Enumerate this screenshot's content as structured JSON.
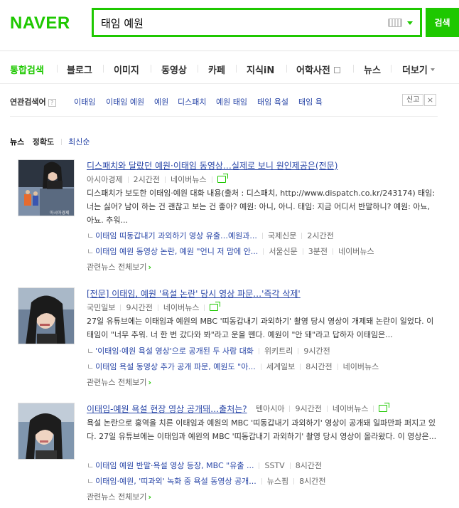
{
  "header": {
    "logo": "NAVER",
    "search_value": "태임 예원",
    "search_button": "검색"
  },
  "nav": {
    "tabs": [
      "통합검색",
      "블로그",
      "이미지",
      "동영상",
      "카페",
      "지식iN",
      "어학사전",
      "뉴스",
      "더보기"
    ]
  },
  "related": {
    "title": "연관검색어",
    "help": "?",
    "items": [
      "이태임",
      "이태임 예원",
      "예원",
      "디스패치",
      "예원 태임",
      "태임 욕설",
      "태임 욕"
    ],
    "report": "신고",
    "close": "×"
  },
  "news": {
    "section_title": "뉴스",
    "sort_accuracy": "정확도",
    "sort_latest": "최신순",
    "related_more": "관련뉴스 전체보기",
    "items": [
      {
        "title": "디스패치와 달랐던 예원·이태임 동영상…실제로 보니 원인제공은(전문)",
        "source": "아시아경제",
        "time": "2시간전",
        "portal": "네이버뉴스",
        "desc": "디스패치가 보도한 이태임·예원 대화 내용(출처 : 디스패치, http://www.dispatch.co.kr/243174) 태임: 너는 싫어? 남이 하는 건 괜찮고 보는 건 좋아? 예원: 아니, 아니. 태임: 지금 어디서 반말하니? 예원: 아뇨, 아뇨. 추워...",
        "subs": [
          {
            "title": "이태임 띠동갑내기 과외하기 영상 유출…예원과...",
            "source": "국제신문",
            "time": "2시간전",
            "portal": ""
          },
          {
            "title": "이태임 예원 동영상 논란, 예원 \"언니 저 맘에 안...",
            "source": "서울신문",
            "time": "3분전",
            "portal": "네이버뉴스"
          }
        ]
      },
      {
        "title": "[전문] 이태임, 예원 '욕설 논란' 당시 영상 파문…'즉각 삭제'",
        "source": "국민일보",
        "time": "9시간전",
        "portal": "네이버뉴스",
        "desc": "27일 유튜브에는 이태임과 예원의 MBC '띠동갑내기 과외하기' 촬영 당시 영상이 개제돼 논란이 일었다. 이태임이 \"너무 추워. 너 한 번 갔다와 봐\"라고 운을 뗀다. 예원이 \"안 돼\"라고 답하자 이태임은...",
        "subs": [
          {
            "title": "'이태임·예원 욕설 영상'으로 공개된 두 사람 대화",
            "source": "위키트리",
            "time": "9시간전",
            "portal": ""
          },
          {
            "title": "이태임 욕설 동영상 추가 공개 파문, 예원도 \"아...",
            "source": "세계일보",
            "time": "8시간전",
            "portal": "네이버뉴스"
          }
        ]
      },
      {
        "title": "이태임-예원 욕설 현장 영상 공개돼…출처는?",
        "source": "텐아시아",
        "time": "9시간전",
        "portal": "네이버뉴스",
        "desc": "욕설 논란으로 홍역을 치른 이태임과 예원의 MBC '띠동갑내기 과외하기' 영상이 공개돼 일파만파 퍼지고 있다. 27일 유튜브에는 이태임과 예원의 MBC '띠동갑내기 과외하기' 촬영 당시 영상이 올라왔다. 이 영상은...",
        "subs": [
          {
            "title": "이태임 예원 반말·욕설 영상 등장, MBC \"유출 ...",
            "source": "SSTV",
            "time": "8시간전",
            "portal": ""
          },
          {
            "title": "이태임·예원, '띠과외' 녹화 중 욕설 동영상 공개...",
            "source": "뉴스핌",
            "time": "8시간전",
            "portal": ""
          }
        ]
      }
    ],
    "thumb1_caption": "아시아경제"
  }
}
